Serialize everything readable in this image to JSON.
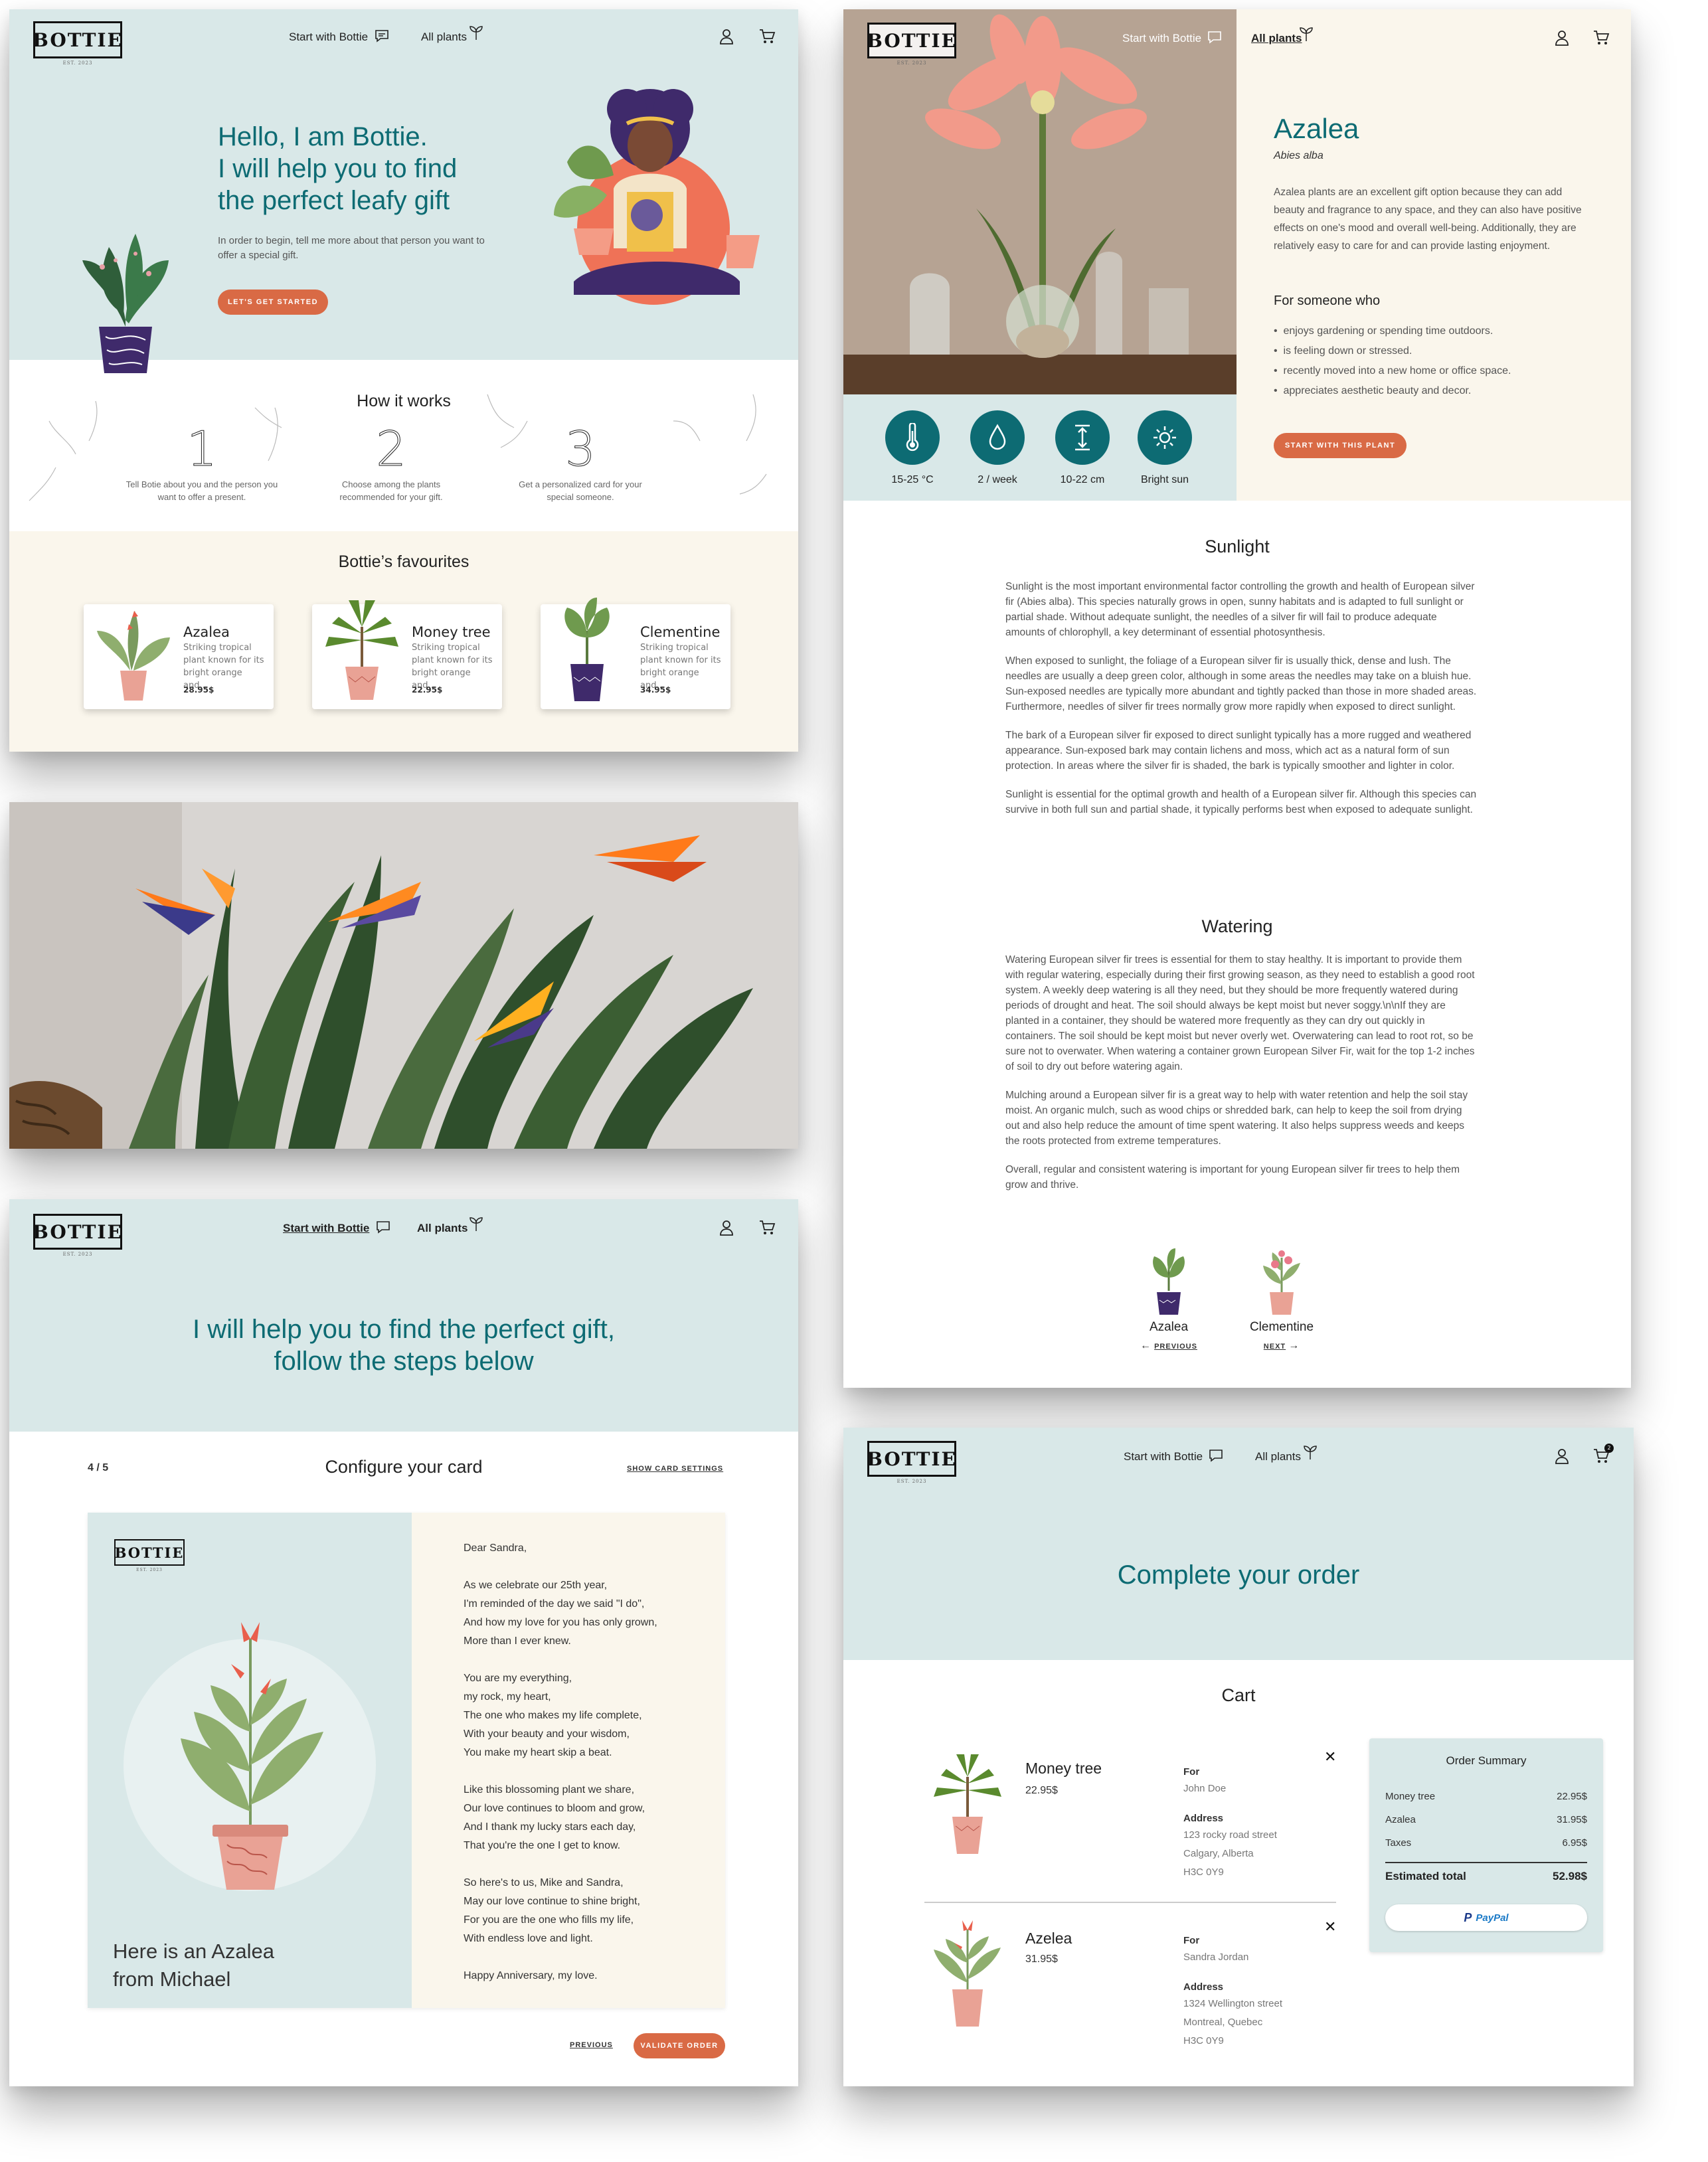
{
  "brand": {
    "logo": "BOTTIE",
    "tagline": "EST. 2023"
  },
  "nav": {
    "start": "Start with Bottie",
    "plants": "All plants"
  },
  "home": {
    "hero_title_1": "Hello, I am Bottie.",
    "hero_title_2": "I will help you to find",
    "hero_title_3": "the perfect leafy gift",
    "hero_desc": "In order to begin, tell me more about that person you want to offer a special gift.",
    "cta": "LET'S GET STARTED",
    "how_title": "How it works",
    "steps": [
      {
        "num": "1",
        "text": "Tell Botie about you and the person you want to offer a present."
      },
      {
        "num": "2",
        "text": "Choose among the plants recommended for your gift."
      },
      {
        "num": "3",
        "text": "Get a personalized card for your special someone."
      }
    ],
    "fav_title": "Bottie’s favourites",
    "favourites": [
      {
        "name": "Azalea",
        "desc": "Striking tropical plant known for its bright orange and...",
        "price": "28.95$"
      },
      {
        "name": "Money tree",
        "desc": "Striking tropical plant known for its bright orange and...",
        "price": "22.95$"
      },
      {
        "name": "Clementine",
        "desc": "Striking tropical plant known for its bright orange and...",
        "price": "34.95$"
      }
    ]
  },
  "card_page": {
    "title_1": "I will help you to find the perfect gift,",
    "title_2": "follow the steps below",
    "step": "4 / 5",
    "heading": "Configure your card",
    "show_settings": "SHOW CARD SETTINGS",
    "card_caption_1": "Here is an Azalea",
    "card_caption_2": "from Michael",
    "poem": [
      "Dear Sandra,",
      "",
      "As we celebrate our 25th year,",
      "I'm reminded of the day we said \"I do\",",
      "And how my love for you has only grown,",
      "More than I ever knew.",
      "",
      "You are my everything,",
      "my rock, my heart,",
      "The one who makes my life complete,",
      "With your beauty and your wisdom,",
      "You make my heart skip a beat.",
      "",
      "Like this blossoming plant we share,",
      "Our love continues to bloom and grow,",
      "And I thank my lucky stars each day,",
      "That you're the one I get to know.",
      "",
      "So here's to us, Mike and Sandra,",
      "May our love continue to shine bright,",
      "For you are the one who fills my life,",
      "With endless love and light.",
      "",
      "Happy Anniversary, my love."
    ],
    "previous": "PREVIOUS",
    "validate": "VALIDATE ORDER"
  },
  "plant_page": {
    "name": "Azalea",
    "latin": "Abies alba",
    "desc": "Azalea plants are an excellent gift option because they can add beauty and fragrance to any space, and they can also have positive effects on one's mood and overall well-being. Additionally, they are relatively easy to care for and can provide lasting enjoyment.",
    "for_title": "For someone who",
    "for_list": [
      "enjoys gardening or spending time outdoors.",
      "is feeling down or stressed.",
      "recently moved into a new home or office space.",
      "appreciates aesthetic beauty and decor."
    ],
    "cta": "START WITH THIS PLANT",
    "stats": [
      {
        "icon": "thermometer-icon",
        "label": "15-25 °C"
      },
      {
        "icon": "water-drop-icon",
        "label": "2 / week"
      },
      {
        "icon": "height-icon",
        "label": "10-22 cm"
      },
      {
        "icon": "sun-icon",
        "label": "Bright sun"
      }
    ],
    "sunlight_title": "Sunlight",
    "sunlight": [
      "Sunlight is the most important environmental factor controlling the growth and health of European silver fir (Abies alba). This species naturally grows in open, sunny habitats and is adapted to full sunlight or partial shade. Without adequate sunlight, the needles of a silver fir will fail to produce adequate amounts of chlorophyll, a key determinant of essential photosynthesis.",
      "When exposed to sunlight, the foliage of a European silver fir is usually thick, dense and lush. The needles are usually a deep green color, although in some areas the needles may take on a bluish hue. Sun-exposed needles are typically more abundant and tightly packed than those in more shaded areas. Furthermore, needles of silver fir trees normally grow more rapidly when exposed to direct sunlight.",
      "The bark of a European silver fir exposed to direct sunlight typically has a more rugged and weathered appearance. Sun-exposed bark may contain lichens and moss, which act as a natural form of sun protection. In areas where the silver fir is shaded, the bark is typically smoother and lighter in color.",
      "Sunlight is essential for the optimal growth and health of a European silver fir. Although this species can survive in both full sun and partial shade, it typically performs best when exposed to adequate sunlight."
    ],
    "watering_title": "Watering",
    "watering": [
      "Watering European silver fir trees is essential for them to stay healthy. It is important to provide them with regular watering, especially during their first growing season, as they need to establish a good root system. A weekly deep watering is all they need, but they should be more frequently watered during periods of drought and heat. The soil should always be kept moist but never soggy.\\n\\nIf they are planted in a container, they should be watered more frequently as they can dry out quickly in containers. The soil should be kept moist but never overly wet. Overwatering can lead to root rot, so be sure not to overwater. When watering a container grown European Silver Fir, wait for the top 1-2 inches of soil to dry out before watering again.",
      "Mulching around a European silver fir is a great way to help with water retention and help the soil stay moist. An organic mulch, such as wood chips or shredded bark, can help to keep the soil from drying out and also help reduce the amount of time spent watering. It also helps suppress weeds and keeps the roots protected from extreme temperatures.",
      "Overall, regular and consistent watering is important for young European silver fir trees to help them grow and thrive."
    ],
    "prev_name": "Azalea",
    "prev_label": "PREVIOUS",
    "next_name": "Clementine",
    "next_label": "NEXT"
  },
  "order_page": {
    "title": "Complete your order",
    "cart_title": "Cart",
    "cart_badge": "2",
    "items": [
      {
        "name": "Money tree",
        "price": "22.95$",
        "for_label": "For",
        "for": "John Doe",
        "address_label": "Address",
        "address": [
          "123 rocky road street",
          "Calgary, Alberta",
          "H3C 0Y9"
        ]
      },
      {
        "name": "Azelea",
        "price": "31.95$",
        "for_label": "For",
        "for": "Sandra Jordan",
        "address_label": "Address",
        "address": [
          "1324 Wellington street",
          "Montreal, Quebec",
          "H3C 0Y9"
        ]
      }
    ],
    "summary": {
      "title": "Order Summary",
      "lines": [
        {
          "label": "Money tree",
          "value": "22.95$"
        },
        {
          "label": "Azalea",
          "value": "31.95$"
        },
        {
          "label": "Taxes",
          "value": "6.95$"
        }
      ],
      "total_label": "Estimated total",
      "total": "52.98$",
      "paypal": "PayPal"
    }
  },
  "colors": {
    "teal": "#0d6b73",
    "mint": "#d9e8e8",
    "cream": "#faf6ec",
    "orange": "#d96a45",
    "purple": "#3f2a6b"
  }
}
